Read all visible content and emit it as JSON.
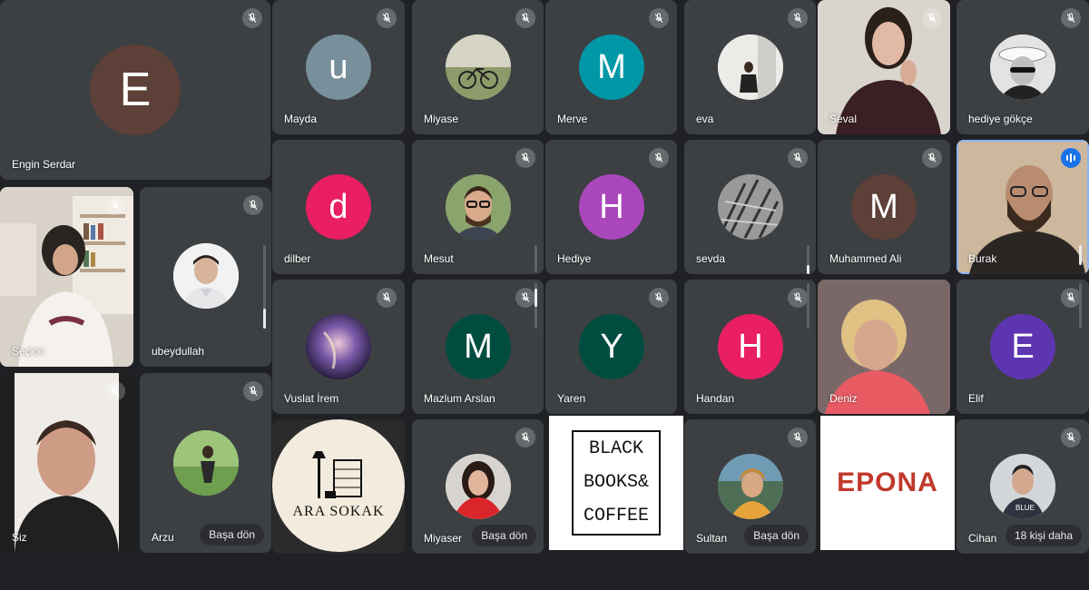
{
  "colors": {
    "background": "#202124",
    "tile": "#3c4043",
    "speaking_border": "#8ab4f8",
    "speaking_badge": "#1a73e8"
  },
  "tiles": [
    {
      "name": "Engin Serdar",
      "initial": "E",
      "avatar_color": "#5d4037"
    },
    {
      "name": "Mayda",
      "initial": "u",
      "avatar_color": "#78909c"
    },
    {
      "name": "Miyase"
    },
    {
      "name": "Merve",
      "initial": "M",
      "avatar_color": "#0097a7"
    },
    {
      "name": "eva"
    },
    {
      "name": "Seval"
    },
    {
      "name": "hediye gökçe"
    },
    {
      "name": "Seçkin"
    },
    {
      "name": "ubeydullah"
    },
    {
      "name": "dilber",
      "initial": "d",
      "avatar_color": "#e91e63"
    },
    {
      "name": "Mesut"
    },
    {
      "name": "Hediye",
      "initial": "H",
      "avatar_color": "#ab47bc"
    },
    {
      "name": "sevda"
    },
    {
      "name": "Muhammed Ali",
      "initial": "M",
      "avatar_color": "#5d4037"
    },
    {
      "name": "Burak"
    },
    {
      "name": "Vuslat İrem"
    },
    {
      "name": "Mazlum Arslan",
      "initial": "M",
      "avatar_color": "#004d40"
    },
    {
      "name": "Yaren",
      "initial": "Y",
      "avatar_color": "#004d40"
    },
    {
      "name": "Handan",
      "initial": "H",
      "avatar_color": "#e91e63"
    },
    {
      "name": "Deniz"
    },
    {
      "name": "Elif",
      "initial": "E",
      "avatar_color": "#5e35b1"
    },
    {
      "name": "Siz"
    },
    {
      "name": "Arzu",
      "pill": "Başa dön"
    },
    {
      "name": "Miyaser",
      "pill": "Başa dön"
    },
    {
      "name": "Sultan",
      "pill": "Başa dön"
    },
    {
      "name": "Cihan",
      "pill": "18 kişi daha"
    }
  ],
  "logos": {
    "ara_sokak": "ARA SOKAK",
    "black_books": [
      "BLACK",
      "BOOKS&",
      "COFFEE"
    ],
    "epona": "EPONA"
  }
}
